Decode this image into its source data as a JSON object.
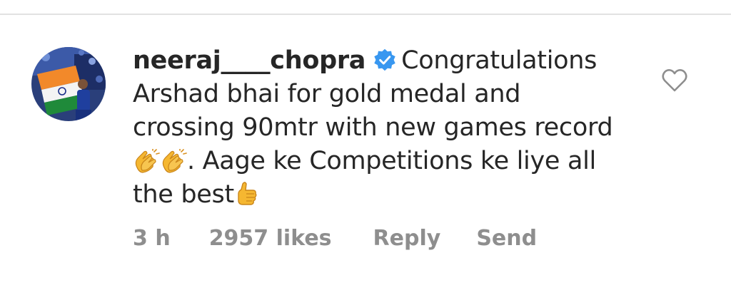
{
  "comment": {
    "username": "neeraj____chopra",
    "verified": true,
    "text_line1": "Congratulations",
    "text_line2": "Arshad bhai for gold medal and",
    "text_line3": "crossing 90mtr with new games record",
    "text_line4": ". Aage ke Competitions ke liye all",
    "text_line5": "the best",
    "emojis": [
      "clapping-hands-icon",
      "clapping-hands-icon",
      "thumbs-up-icon"
    ]
  },
  "meta": {
    "time": "3 h",
    "likes": "2957 likes",
    "reply_label": "Reply",
    "send_label": "Send"
  },
  "colors": {
    "text": "#262626",
    "muted": "#8e8e8e",
    "verified_blue": "#3897f0",
    "divider": "#e2e2e2",
    "emoji_yellow": "#f5b731"
  }
}
